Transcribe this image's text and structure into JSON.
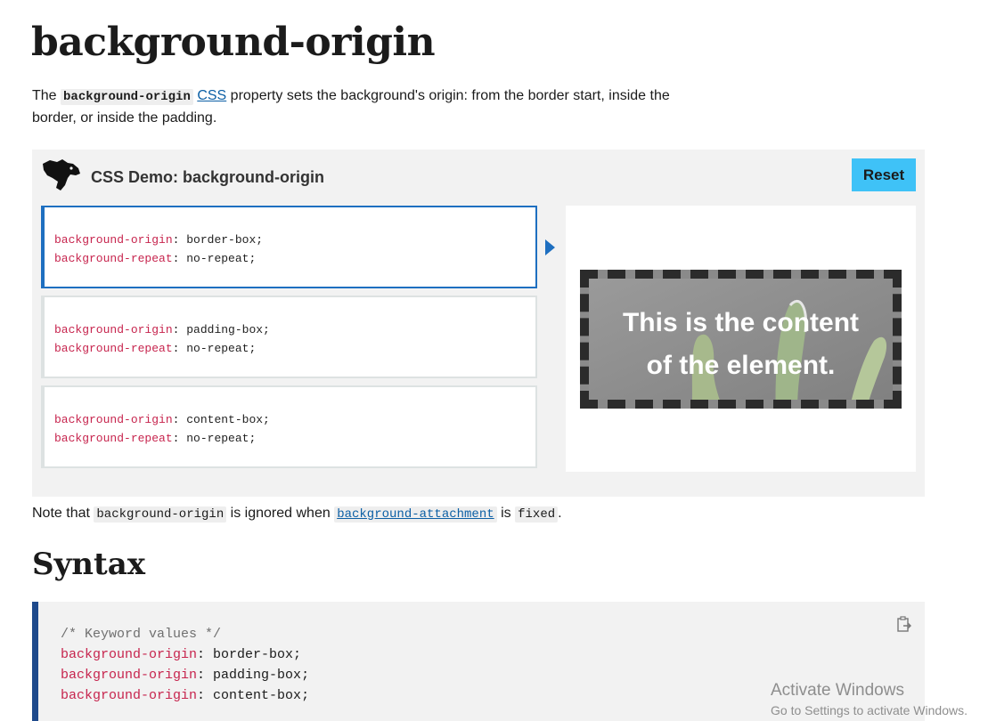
{
  "page": {
    "title": "background-origin",
    "intro": {
      "prefix": "The",
      "code": "background-origin",
      "link": "CSS",
      "suffix": "property sets the background's origin: from the border start, inside the border, or inside the padding."
    }
  },
  "demo": {
    "title": "CSS Demo: background-origin",
    "reset_label": "Reset",
    "choices": [
      {
        "line1_prop": "background-origin",
        "line1_val": "border-box;",
        "line2_prop": "background-repeat",
        "line2_val": "no-repeat;",
        "selected": true
      },
      {
        "line1_prop": "background-origin",
        "line1_val": "padding-box;",
        "line2_prop": "background-repeat",
        "line2_val": "no-repeat;",
        "selected": false
      },
      {
        "line1_prop": "background-origin",
        "line1_val": "content-box;",
        "line2_prop": "background-repeat",
        "line2_val": "no-repeat;",
        "selected": false
      }
    ],
    "output": {
      "line1": "This is the content",
      "line2": "of the element."
    }
  },
  "note": {
    "prefix": "Note that",
    "code1": "background-origin",
    "middle": "is ignored when",
    "code2_link": "background-attachment",
    "is_word": "is",
    "code3": "fixed",
    "end": "."
  },
  "syntax": {
    "heading": "Syntax",
    "code_comment": "/* Keyword values */",
    "lines": [
      {
        "prop": "background-origin",
        "val": "border-box;"
      },
      {
        "prop": "background-origin",
        "val": "padding-box;"
      },
      {
        "prop": "background-origin",
        "val": "content-box;"
      }
    ]
  },
  "watermark": {
    "line1": "Activate Windows",
    "line2": "Go to Settings to activate Windows."
  },
  "colors": {
    "accent_blue": "#1e6fc0",
    "reset_button": "#3fc2f7",
    "property_red": "#c7254e",
    "link": "#0b5fa5"
  },
  "icons": [
    "mdn-dino-logo-icon",
    "play-arrow-icon",
    "copy-clipboard-icon"
  ]
}
